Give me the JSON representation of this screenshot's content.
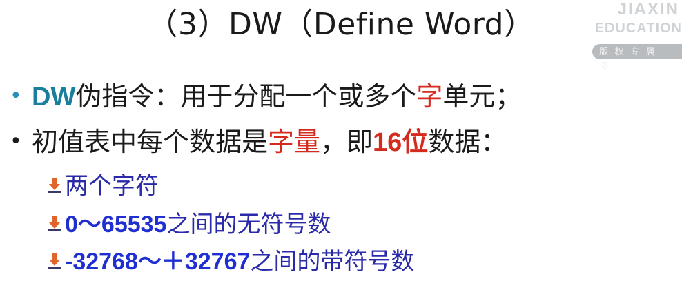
{
  "title": "（3）DW（Define Word）",
  "watermark": {
    "brand": "JIAXIN",
    "sub": "EDUCATION",
    "badge": "版 权 专 属 · 侵"
  },
  "bullets": [
    {
      "parts": [
        {
          "text": "DW",
          "style": "teal"
        },
        {
          "text": "伪指令：用于分配一个或多个",
          "style": "normal"
        },
        {
          "text": "字",
          "style": "red"
        },
        {
          "text": "单元；",
          "style": "normal"
        }
      ]
    },
    {
      "parts": [
        {
          "text": "初值表中每个数据是",
          "style": "normal"
        },
        {
          "text": "字量",
          "style": "red"
        },
        {
          "text": "，即",
          "style": "normal"
        },
        {
          "text": "16位",
          "style": "red-bold"
        },
        {
          "text": "数据：",
          "style": "normal"
        }
      ]
    }
  ],
  "sub_items": [
    {
      "num": "",
      "text": "两个字符"
    },
    {
      "num": "0～65535",
      "text": "之间的无符号数"
    },
    {
      "num": "-32768～＋32767",
      "text": "之间的带符号数"
    }
  ],
  "colors": {
    "bullet_dot": "#2a8fb8",
    "teal": "#1a7f9c",
    "red": "#d52b1e",
    "sub_text": "#2a2aa8",
    "arrow_fill": "#e0652a"
  },
  "icons": {
    "bullet": "bullet-dot-icon",
    "sub_bullet": "down-arrow-bar-icon"
  }
}
